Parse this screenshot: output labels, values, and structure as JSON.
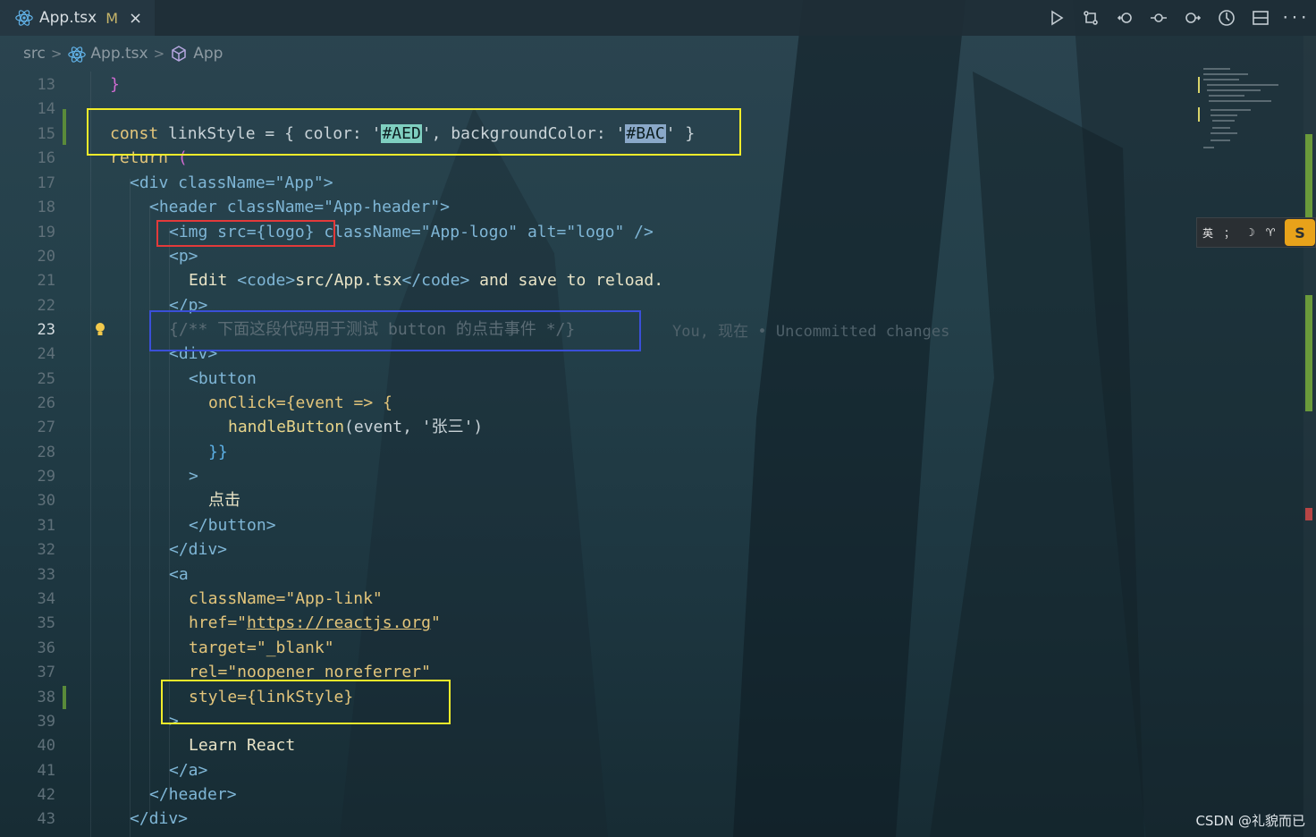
{
  "tab": {
    "filename": "App.tsx",
    "status": "M",
    "close": "×"
  },
  "toolbar": {
    "icons": [
      "run-icon",
      "git-compare-icon",
      "go-back-icon",
      "git-commit-icon",
      "go-forward-icon",
      "timeline-icon",
      "split-editor-icon",
      "more-actions-icon"
    ],
    "more": "···"
  },
  "breadcrumb": {
    "folder": "src",
    "file": "App.tsx",
    "symbol": "App",
    "sep": ">"
  },
  "lines": [
    {
      "n": "13"
    },
    {
      "n": "14"
    },
    {
      "n": "15"
    },
    {
      "n": "16"
    },
    {
      "n": "17"
    },
    {
      "n": "18"
    },
    {
      "n": "19"
    },
    {
      "n": "20"
    },
    {
      "n": "21"
    },
    {
      "n": "22"
    },
    {
      "n": "23"
    },
    {
      "n": "24"
    },
    {
      "n": "25"
    },
    {
      "n": "26"
    },
    {
      "n": "27"
    },
    {
      "n": "28"
    },
    {
      "n": "29"
    },
    {
      "n": "30"
    },
    {
      "n": "31"
    },
    {
      "n": "32"
    },
    {
      "n": "33"
    },
    {
      "n": "34"
    },
    {
      "n": "35"
    },
    {
      "n": "36"
    },
    {
      "n": "37"
    },
    {
      "n": "38"
    },
    {
      "n": "39"
    },
    {
      "n": "40"
    },
    {
      "n": "41"
    },
    {
      "n": "42"
    },
    {
      "n": "43"
    }
  ],
  "code": {
    "l13": "}",
    "l15_const": "const",
    "l15_name": " linkStyle = { color: '",
    "l15_c1": "#AED",
    "l15_mid": "', backgroundColor: '",
    "l15_c2": "#BAC",
    "l15_end": "' }",
    "l16_kw": "return",
    "l16_paren": " (",
    "l17": "<div className=\"App\">",
    "l18": "<header className=\"App-header\">",
    "l19": "<img src={logo} className=\"App-logo\" alt=\"logo\" />",
    "l20": "<p>",
    "l21_a": "Edit ",
    "l21_b": "<code>",
    "l21_c": "src/App.tsx",
    "l21_d": "</code>",
    "l21_e": " and save to reload.",
    "l22": "</p>",
    "l23": "{/** 下面这段代码用于测试 button 的点击事件 */}",
    "l24": "<div>",
    "l25": "<button",
    "l26": "onClick={event => {",
    "l27_fn": "handleButton",
    "l27_rest": "(event, '张三')",
    "l28": "}}",
    "l29": ">",
    "l30": "点击",
    "l31": "</button>",
    "l32": "</div>",
    "l33": "<a",
    "l34": "className=\"App-link\"",
    "l35_a": "href=\"",
    "l35_url": "https://reactjs.org",
    "l35_b": "\"",
    "l36": "target=\"_blank\"",
    "l37": "rel=\"noopener noreferrer\"",
    "l38": "style={linkStyle}",
    "l39": ">",
    "l40": "Learn React",
    "l41": "</a>",
    "l42": "</header>",
    "l43": "</div>"
  },
  "blame": "You, 现在 • Uncommitted changes",
  "ime": {
    "lang": "英",
    "punct": "；",
    "moon": "☽",
    "shirt": "♈",
    "logo": "S"
  },
  "watermark": "CSDN @礼貌而已",
  "colors": {
    "annot_yellow": "#f1ec2a",
    "annot_red": "#e33a3a",
    "annot_blue": "#3a4fd8",
    "git_modified": "#5a8a3a"
  }
}
